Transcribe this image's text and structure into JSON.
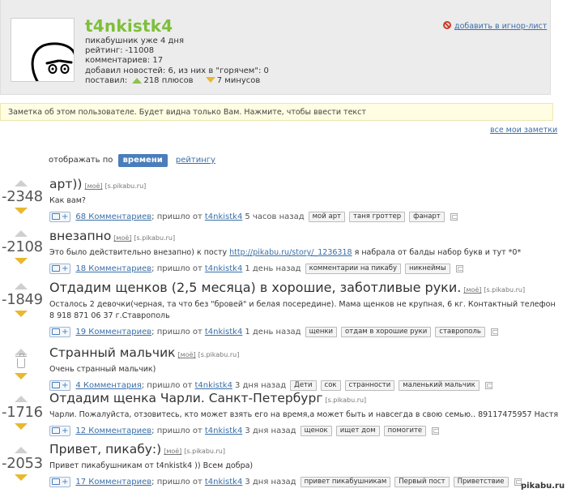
{
  "profile": {
    "username": "t4nkistk4",
    "stats": [
      "пикабушник уже 4 дня",
      "рейтинг: -11008",
      "комментариев: 17",
      "добавил новостей: 6, из них в \"горячем\": 0"
    ],
    "placed_label": "поставил:",
    "pluses": "218 плюсов",
    "minuses": "7 минусов",
    "ignore_link": "добавить в игнор-лист"
  },
  "note": {
    "text": "Заметка об этом пользователе. Будет видна только Вам. Нажмите, чтобы ввести текст",
    "all_notes": "все мои заметки"
  },
  "sort": {
    "label": "отображать по",
    "active": "времени",
    "other": "рейтингу"
  },
  "posts": [
    {
      "rating": "-2348",
      "title": "арт))",
      "mine": "[моё]",
      "source": "[s.pikabu.ru]",
      "text": "Как вам?",
      "comments": "68 Комментариев",
      "came_from": "; пришло от",
      "author": "t4nkistk4",
      "time": "5 часов назад",
      "tags": [
        "мой арт",
        "таня гроттер",
        "фанарт"
      ]
    },
    {
      "rating": "-2108",
      "title": "внезапно",
      "mine": "[моё]",
      "source": "[s.pikabu.ru]",
      "text_before": "Это было действительно внезапно) к посту ",
      "text_link": "http://pikabu.ru/story/_1236318",
      "text_after": " я набрала от балды набор букв и тут *0*",
      "comments": "18 Комментариев",
      "came_from": "; пришло от",
      "author": "t4nkistk4",
      "time": "1 день назад",
      "tags": [
        "комментарии на пикабу",
        "никнеймы"
      ]
    },
    {
      "rating": "-1849",
      "title": "Отдадим щенков (2,5 месяца) в хорошие, заботливые руки.",
      "mine": "[моё]",
      "source": "[s.pikabu.ru]",
      "text": "Осталось 2 девочки(черная, та что без \"бровей\" и белая посередине). Мама щенков не крупная, 6 кг. Контактный телефон 8 918 871 06 37 г.Ставрополь",
      "comments": "19 Комментариев",
      "came_from": "; пришло от",
      "author": "t4nkistk4",
      "time": "1 день назад",
      "tags": [
        "щенки",
        "отдам в хорошие руки",
        "ставрополь"
      ]
    },
    {
      "rating": "",
      "title": "Странный мальчик",
      "mine": "[моё]",
      "source": "[s.pikabu.ru]",
      "text": "Очень странный мальчик)",
      "comments": "4 Комментария",
      "came_from": "; пришло от",
      "author": "t4nkistk4",
      "time": "3 дня назад",
      "tags": [
        "Дети",
        "сок",
        "странности",
        "маленький мальчик"
      ]
    },
    {
      "rating": "-1716",
      "title": "Отдадим щенка Чарли. Санкт-Петербург",
      "mine": "",
      "source": "[s.pikabu.ru]",
      "text": "Чарли. Пожалуйста, отзовитесь, кто может взять его на время,а может быть и навсегда в свою семью.. 89117475957 Настя",
      "comments": "12 Комментариев",
      "came_from": "; пришло от",
      "author": "t4nkistk4",
      "time": "3 дня назад",
      "tags": [
        "щенок",
        "ищет дом",
        "помогите"
      ]
    },
    {
      "rating": "-2053",
      "title": "Привет, пикабу:)",
      "mine": "[моё]",
      "source": "[s.pikabu.ru]",
      "text": "Привет пикабушникам от t4nkistk4 )) Всем добра)",
      "comments": "17 Комментариев",
      "came_from": "; пришло от",
      "author": "t4nkistk4",
      "time": "3 дня назад",
      "tags": [
        "привет пикабушникам",
        "Первый пост",
        "Приветствие"
      ]
    }
  ],
  "watermark": "pikabu.ru"
}
